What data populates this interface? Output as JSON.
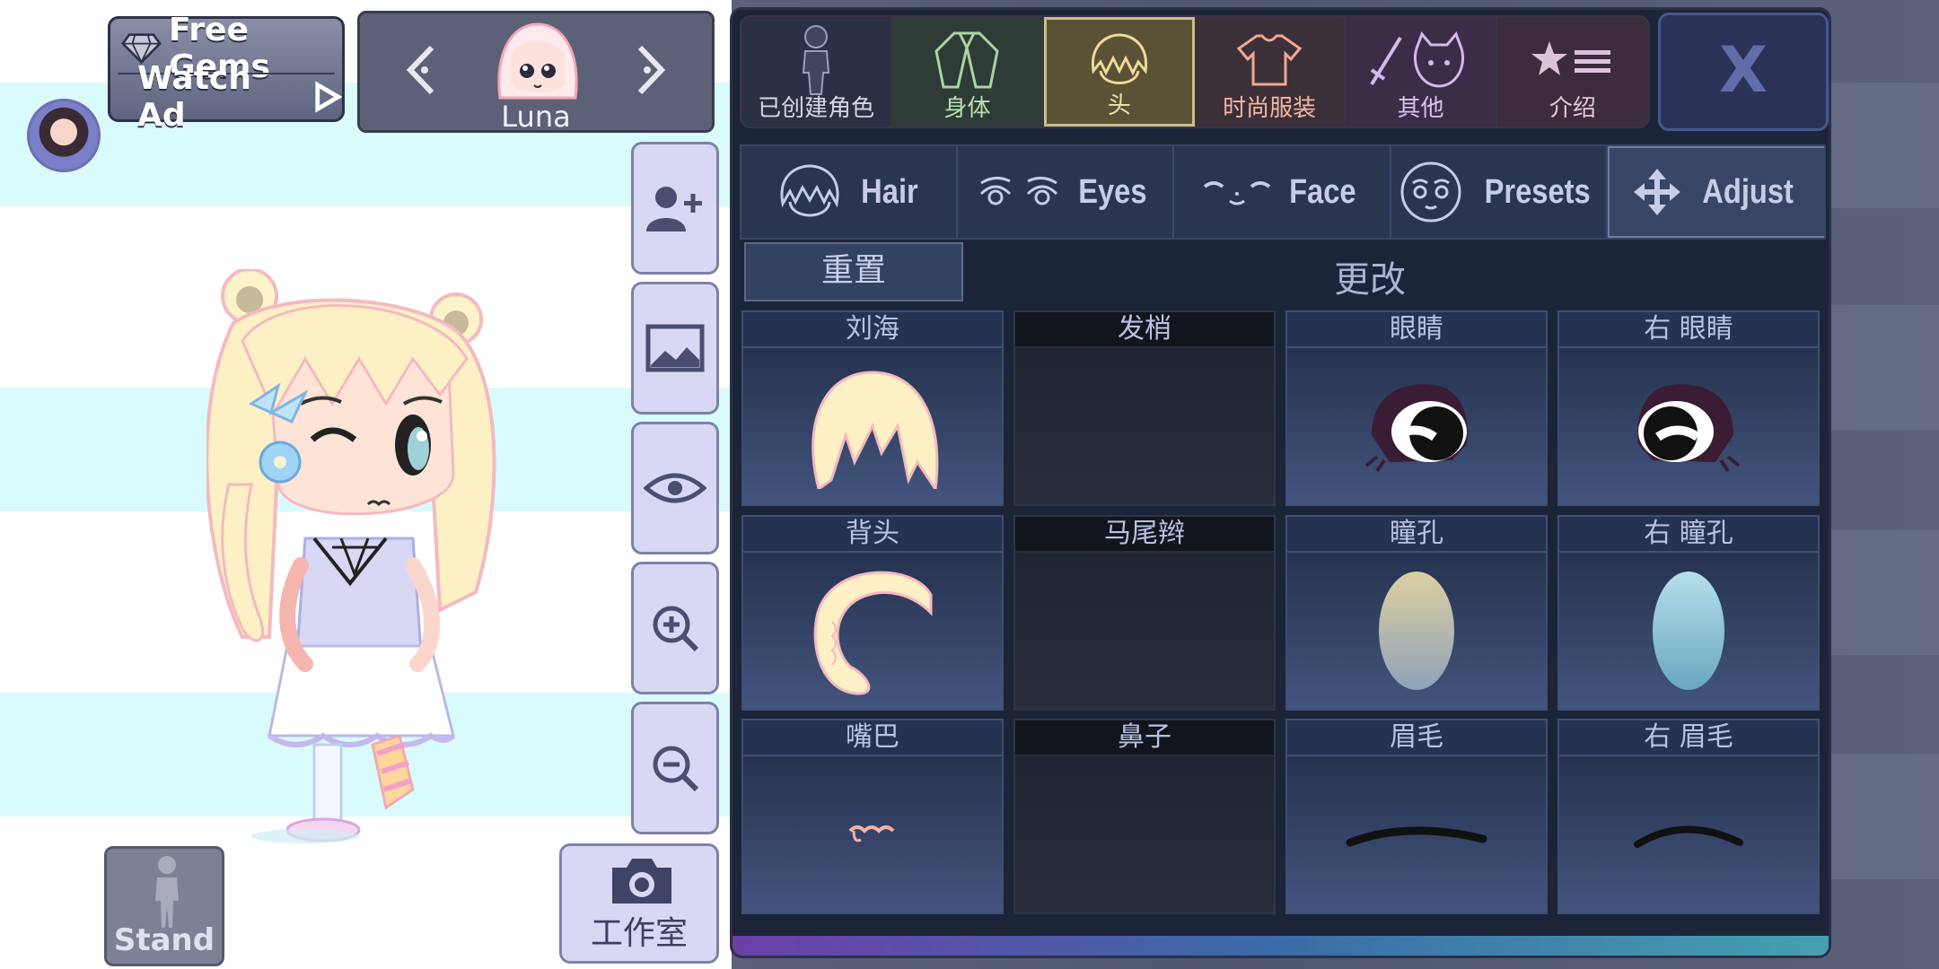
{
  "top_left": {
    "free_gems_label": "Free Gems",
    "watch_ad_label": "Watch Ad",
    "gem_icon": "gem-icon",
    "play_icon": "play-triangle-icon"
  },
  "character_selector": {
    "name": "Luna",
    "prev_icon": "chevron-left-icon",
    "next_icon": "chevron-right-icon"
  },
  "side_tools": [
    {
      "name": "add-character-icon"
    },
    {
      "name": "background-image-icon"
    },
    {
      "name": "eye-icon"
    },
    {
      "name": "zoom-in-icon"
    },
    {
      "name": "zoom-out-icon"
    }
  ],
  "pose_button": {
    "label": "Stand"
  },
  "studio_button": {
    "label": "工作室",
    "icon": "camera-icon"
  },
  "top_tabs": [
    {
      "label": "已创建角色",
      "color": "#d7d7e6",
      "bg": "#2c3044"
    },
    {
      "label": "身体",
      "color": "#b8e1b3",
      "bg": "#2f3b36"
    },
    {
      "label": "头",
      "color": "#f2e2a4",
      "bg": "#5a5236"
    },
    {
      "label": "时尚服装",
      "color": "#f4b7a2",
      "bg": "#3b2f38"
    },
    {
      "label": "其他",
      "color": "#dcc2f0",
      "bg": "#3a2d45"
    },
    {
      "label": "介绍",
      "color": "#e6c8d6",
      "bg": "#3c2c3d"
    }
  ],
  "close_label": "X",
  "sub_tabs": [
    {
      "label": "Hair",
      "icon": "hair-icon"
    },
    {
      "label": "Eyes",
      "icon": "eyes-icon"
    },
    {
      "label": "Face",
      "icon": "face-icon"
    },
    {
      "label": "Presets",
      "icon": "presets-face-icon"
    },
    {
      "label": "Adjust",
      "icon": "move-arrows-icon",
      "active": true
    }
  ],
  "reset_label": "重置",
  "change_label": "更改",
  "parts": [
    {
      "label": "刘海",
      "preview": "bangs"
    },
    {
      "label": "发梢",
      "preview": "empty"
    },
    {
      "label": "眼睛",
      "preview": "eye-left"
    },
    {
      "label": "右 眼睛",
      "preview": "eye-right"
    },
    {
      "label": "背头",
      "preview": "back-hair"
    },
    {
      "label": "马尾辫",
      "preview": "empty"
    },
    {
      "label": "瞳孔",
      "preview": "pupil-yellow"
    },
    {
      "label": "右 瞳孔",
      "preview": "pupil-blue"
    },
    {
      "label": "嘴巴",
      "preview": "mouth"
    },
    {
      "label": "鼻子",
      "preview": "empty"
    },
    {
      "label": "眉毛",
      "preview": "brow-left"
    },
    {
      "label": "右 眉毛",
      "preview": "brow-right"
    }
  ]
}
